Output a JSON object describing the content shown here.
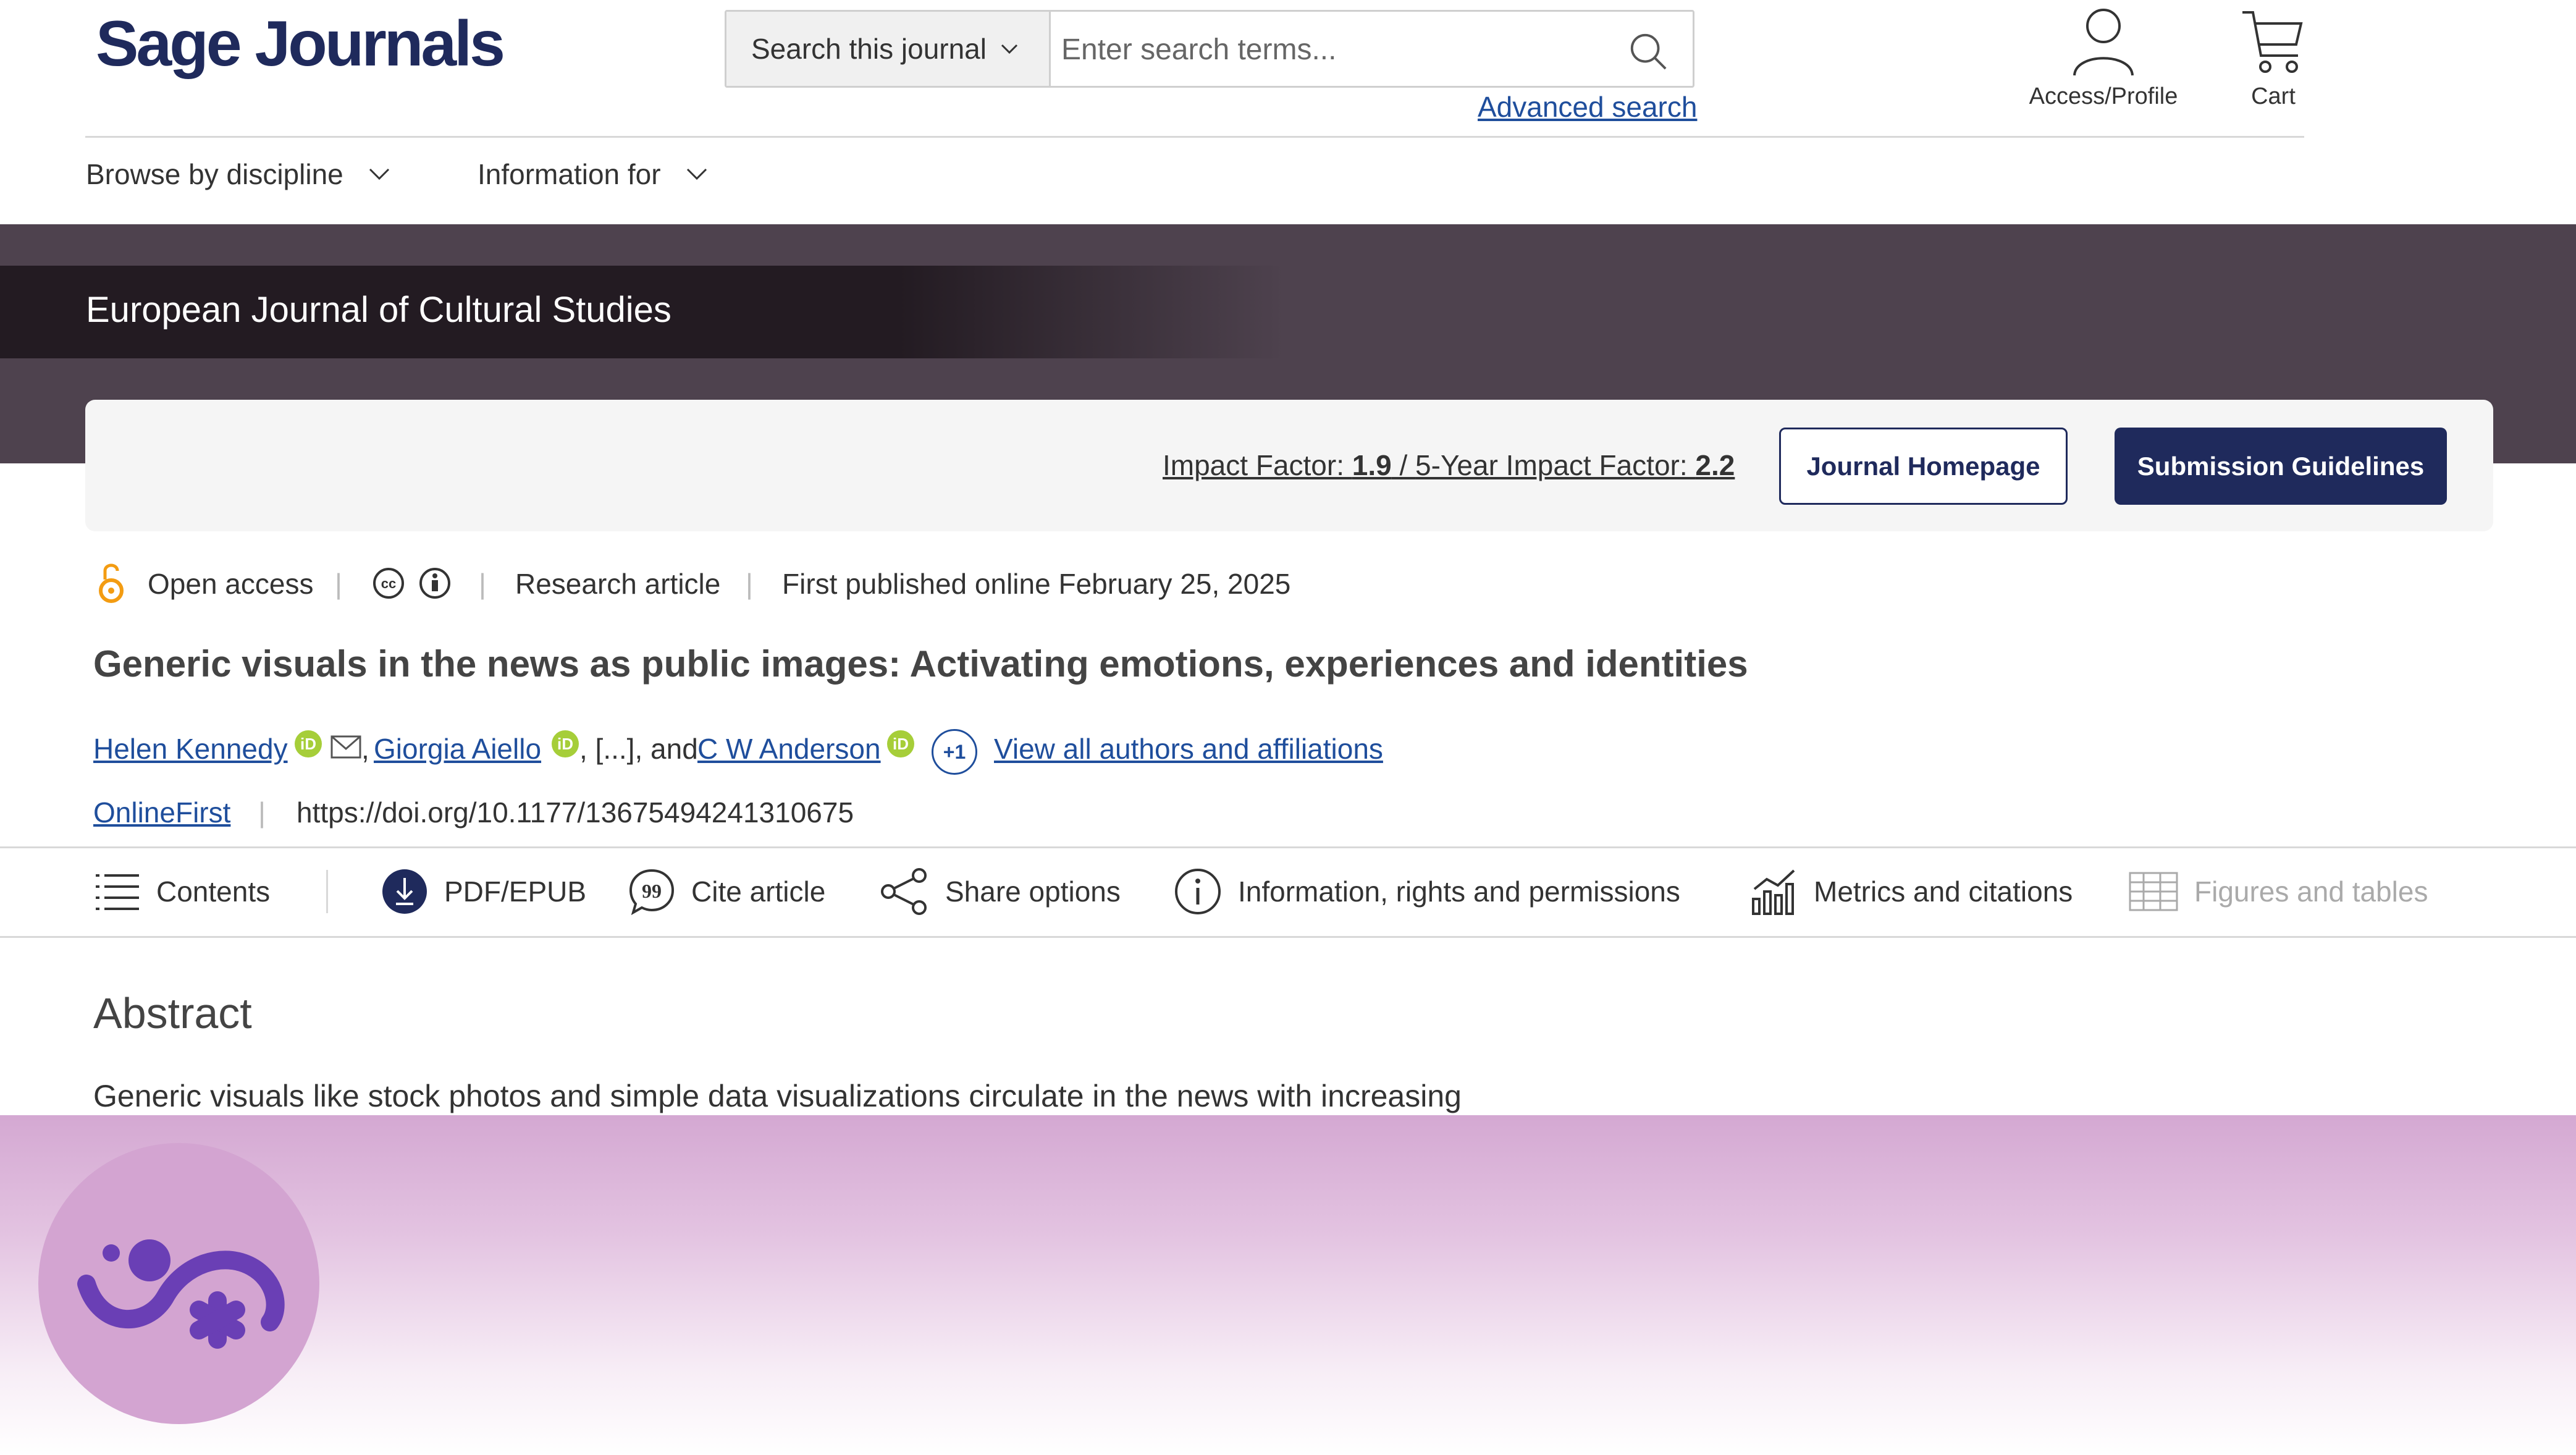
{
  "header": {
    "logo_text": "Sage Journals",
    "search_scope": "Search this journal",
    "search_placeholder": "Enter search terms...",
    "advanced_search": "Advanced search",
    "access_label": "Access/Profile",
    "cart_label": "Cart"
  },
  "nav": {
    "browse": "Browse by discipline",
    "info_for": "Information for"
  },
  "journal": {
    "title": "European Journal of Cultural Studies",
    "impact_prefix": "Impact Factor: ",
    "impact_value": "1.9",
    "impact_sep": " / ",
    "five_year_prefix": "5-Year Impact Factor: ",
    "five_year_value": "2.2",
    "homepage_button": "Journal Homepage",
    "guidelines_button": "Submission Guidelines"
  },
  "article": {
    "access": "Open access",
    "type": "Research article",
    "published": "First published online February 25, 2025",
    "title": "Generic visuals in the news as public images: Activating emotions, experiences and identities",
    "authors": [
      "Helen Kennedy",
      "Giorgia Aiello",
      "C W Anderson"
    ],
    "ellipsis": ", [...], and ",
    "comma": ",",
    "orcid_label": "iD",
    "more_authors": "+1",
    "view_all": "View all authors and affiliations",
    "section": "OnlineFirst",
    "doi": "https://doi.org/10.1177/13675494241310675"
  },
  "toolbar": {
    "items": [
      "Contents",
      "PDF/EPUB",
      "Cite article",
      "Share options",
      "Information, rights and permissions",
      "Metrics and citations",
      "Figures and tables"
    ]
  },
  "abstract": {
    "heading": "Abstract",
    "text": "Generic visuals like stock photos and simple data visualizations circulate in the news with increasing"
  },
  "colors": {
    "brand_navy": "#1f2a5c",
    "banner": "#4e424e",
    "link": "#1f4e9c",
    "open_access": "#f39c12",
    "orcid": "#a6ce39",
    "overlay": "#d3a4d1",
    "overlay_icon": "#6a3fb5"
  }
}
